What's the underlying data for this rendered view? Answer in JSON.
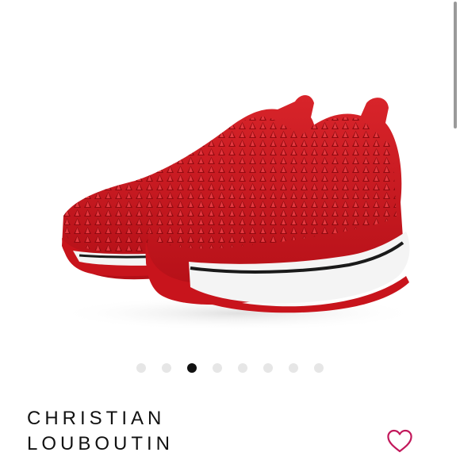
{
  "product": {
    "brand": "CHRISTIAN LOUBOUTIN",
    "image_alt": "red-spiked-sneakers"
  },
  "carousel": {
    "count": 8,
    "active_index": 2
  },
  "colors": {
    "shoe_red": "#c8141c",
    "sole_white": "#f4f4f4",
    "stripe_black": "#1a1a1a",
    "heart_accent": "#c2185b",
    "dot_active": "#111111",
    "dot_inactive": "#e6e6e6"
  },
  "icons": {
    "like": "heart-outline-icon"
  }
}
